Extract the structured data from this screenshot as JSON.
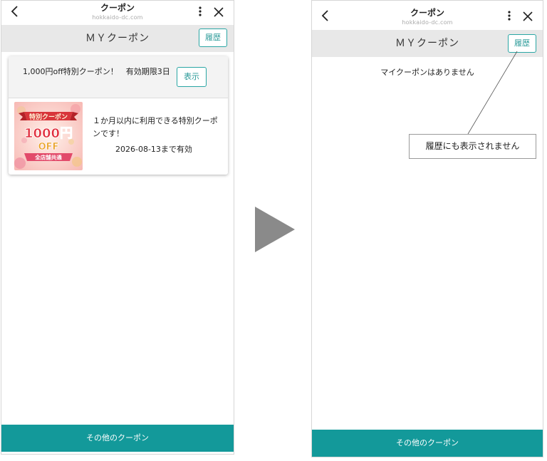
{
  "left_screen": {
    "topbar": {
      "title": "クーポン",
      "domain": "hokkaido-dc.com",
      "back_icon": "chevron-left-icon",
      "menu_icon": "kebab-menu-icon",
      "close_icon": "close-icon"
    },
    "subheader": {
      "title": "ＭＹクーポン",
      "history_button": "履歴"
    },
    "coupon_card": {
      "name": "1,000円off特別クーポン！　有効期限3日",
      "show_button": "表示",
      "image": {
        "banner_text": "特別クーポン",
        "amount_text": "1000円",
        "off_text": "OFF",
        "ribbon_text": "全店舗共通"
      },
      "description": "１か月以内に利用できる特別クーポンです！",
      "expiry": "2026-08-13まで有効"
    },
    "bottom_button": "その他のクーポン"
  },
  "transition_arrow_icon": "play-arrow-icon",
  "right_screen": {
    "topbar": {
      "title": "クーポン",
      "domain": "hokkaido-dc.com",
      "back_icon": "chevron-left-icon",
      "menu_icon": "kebab-menu-icon",
      "close_icon": "close-icon"
    },
    "subheader": {
      "title": "ＭＹクーポン",
      "history_button": "履歴"
    },
    "empty_message": "マイクーポンはありません",
    "bottom_button": "その他のクーポン"
  },
  "annotation": {
    "text": "履歴にも表示されません"
  },
  "colors": {
    "accent": "#13999a",
    "button_border": "#2aa6a4",
    "subheader_bg": "#e8e8e8",
    "arrow": "#8a8a8a"
  }
}
